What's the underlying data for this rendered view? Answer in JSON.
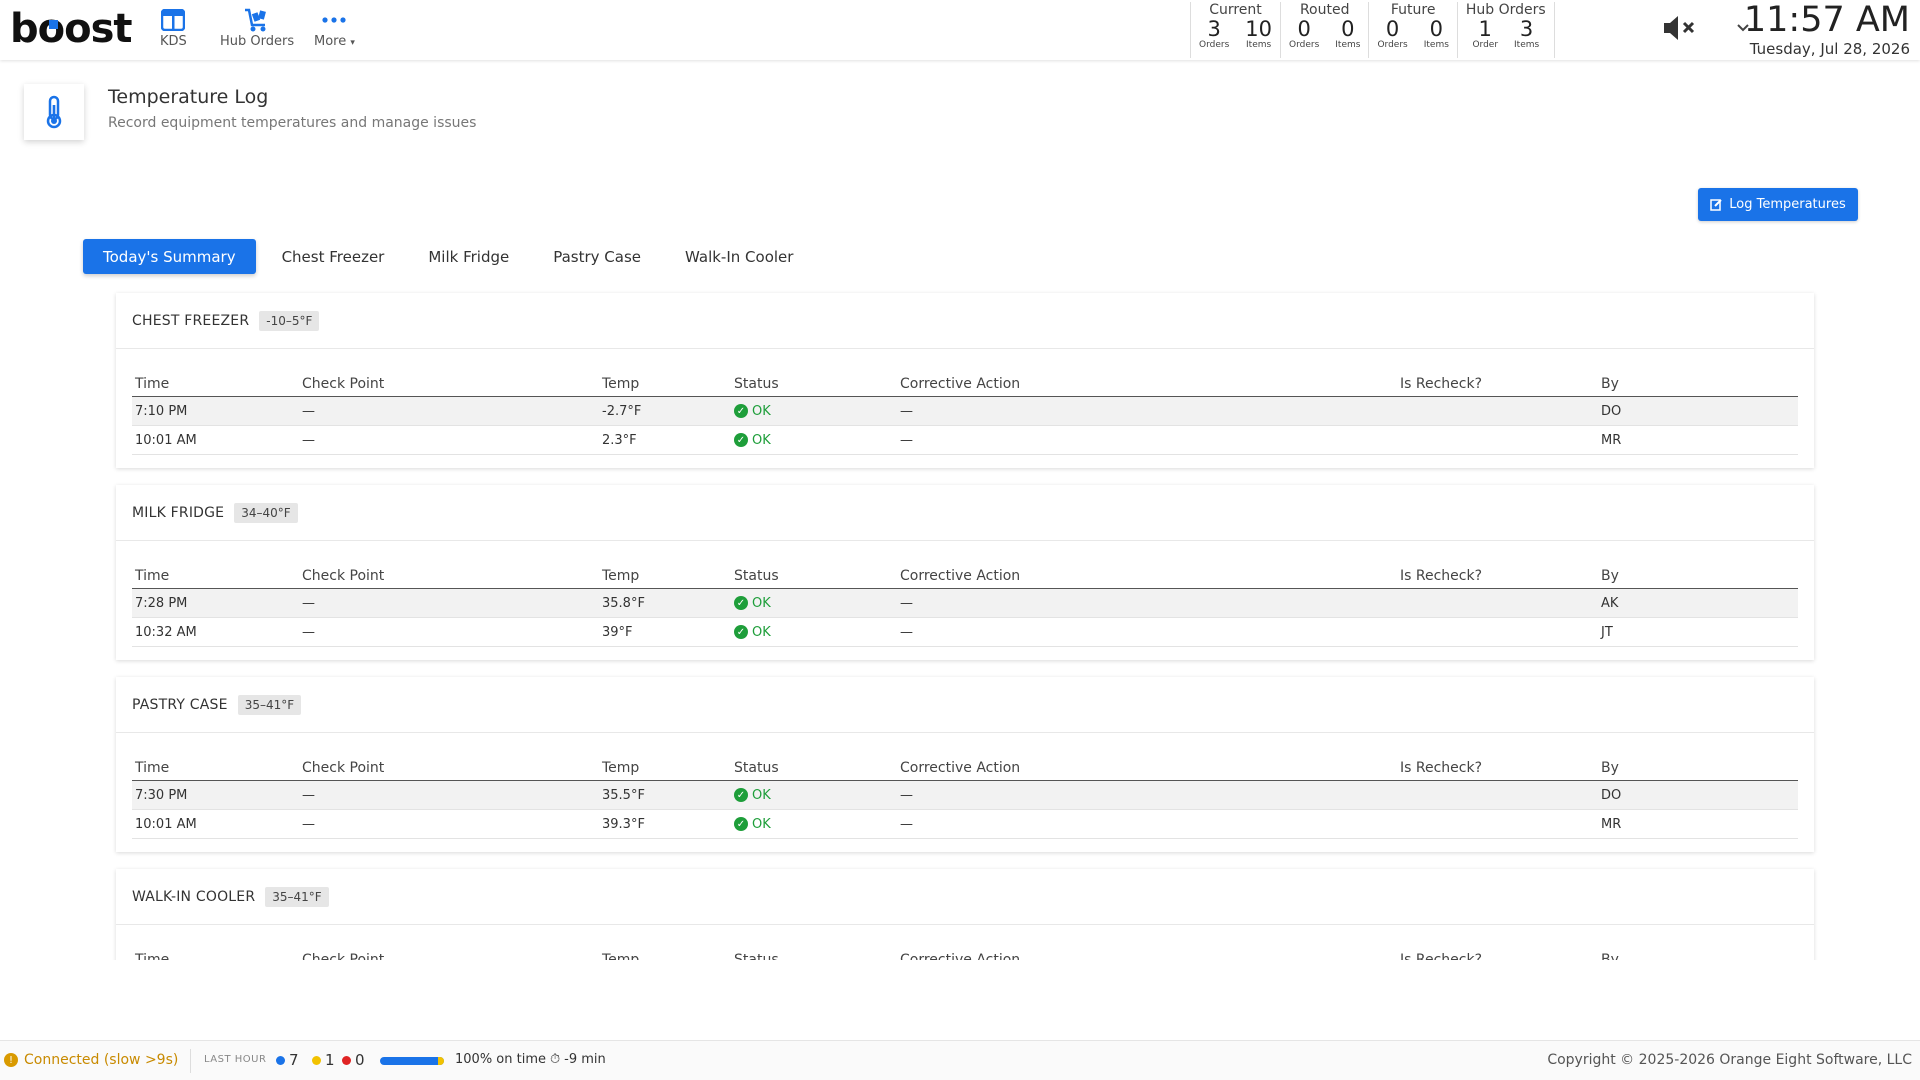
{
  "header": {
    "logo": "boost",
    "nav": [
      {
        "label": "KDS",
        "icon": "kds-icon"
      },
      {
        "label": "Hub Orders",
        "icon": "hub-orders-icon"
      },
      {
        "label": "More",
        "icon": "more-icon"
      }
    ],
    "stats": [
      {
        "title": "Current",
        "cells": [
          {
            "num": "3",
            "lbl": "Orders"
          },
          {
            "num": "10",
            "lbl": "Items"
          }
        ]
      },
      {
        "title": "Routed",
        "cells": [
          {
            "num": "0",
            "lbl": "Orders"
          },
          {
            "num": "0",
            "lbl": "Items"
          }
        ]
      },
      {
        "title": "Future",
        "cells": [
          {
            "num": "0",
            "lbl": "Orders"
          },
          {
            "num": "0",
            "lbl": "Items"
          }
        ]
      },
      {
        "title": "Hub Orders",
        "cells": [
          {
            "num": "1",
            "lbl": "Order"
          },
          {
            "num": "3",
            "lbl": "Items"
          }
        ]
      }
    ],
    "time": "11:57 AM",
    "date": "Tuesday, Jul 28, 2026"
  },
  "page": {
    "title": "Temperature Log",
    "subtitle": "Record equipment temperatures and manage issues",
    "log_button": "Log Temperatures"
  },
  "tabs": [
    "Today's Summary",
    "Chest Freezer",
    "Milk Fridge",
    "Pastry Case",
    "Walk-In Cooler"
  ],
  "columns": [
    "Time",
    "Check Point",
    "Temp",
    "Status",
    "Corrective Action",
    "Is Recheck?",
    "By"
  ],
  "sections": [
    {
      "name": "CHEST FREEZER",
      "range": "-10–5°F",
      "rows": [
        {
          "time": "7:10 PM",
          "checkpoint": "—",
          "temp": "-2.7°F",
          "status": "OK",
          "action": "—",
          "recheck": "",
          "by": "DO"
        },
        {
          "time": "10:01 AM",
          "checkpoint": "—",
          "temp": "2.3°F",
          "status": "OK",
          "action": "—",
          "recheck": "",
          "by": "MR"
        }
      ]
    },
    {
      "name": "MILK FRIDGE",
      "range": "34–40°F",
      "rows": [
        {
          "time": "7:28 PM",
          "checkpoint": "—",
          "temp": "35.8°F",
          "status": "OK",
          "action": "—",
          "recheck": "",
          "by": "AK"
        },
        {
          "time": "10:32 AM",
          "checkpoint": "—",
          "temp": "39°F",
          "status": "OK",
          "action": "—",
          "recheck": "",
          "by": "JT"
        }
      ]
    },
    {
      "name": "PASTRY CASE",
      "range": "35–41°F",
      "rows": [
        {
          "time": "7:30 PM",
          "checkpoint": "—",
          "temp": "35.5°F",
          "status": "OK",
          "action": "—",
          "recheck": "",
          "by": "DO"
        },
        {
          "time": "10:01 AM",
          "checkpoint": "—",
          "temp": "39.3°F",
          "status": "OK",
          "action": "—",
          "recheck": "",
          "by": "MR"
        }
      ]
    },
    {
      "name": "WALK-IN COOLER",
      "range": "35–41°F",
      "rows": []
    }
  ],
  "footer": {
    "connection": "Connected (slow >9s)",
    "last_hour_label": "LAST HOUR",
    "counts": [
      {
        "value": "7",
        "color": "#1a73e8"
      },
      {
        "value": "1",
        "color": "#f2c200"
      },
      {
        "value": "0",
        "color": "#e02424"
      }
    ],
    "on_time_fraction": 0.9,
    "on_time": "100% on time",
    "timer": "-9 min",
    "copyright": "Copyright © 2025-2026 Orange Eight Software, LLC"
  },
  "colors": {
    "accent": "#1a73e8",
    "ok": "#1e9e3a",
    "warning": "#d99a00"
  }
}
